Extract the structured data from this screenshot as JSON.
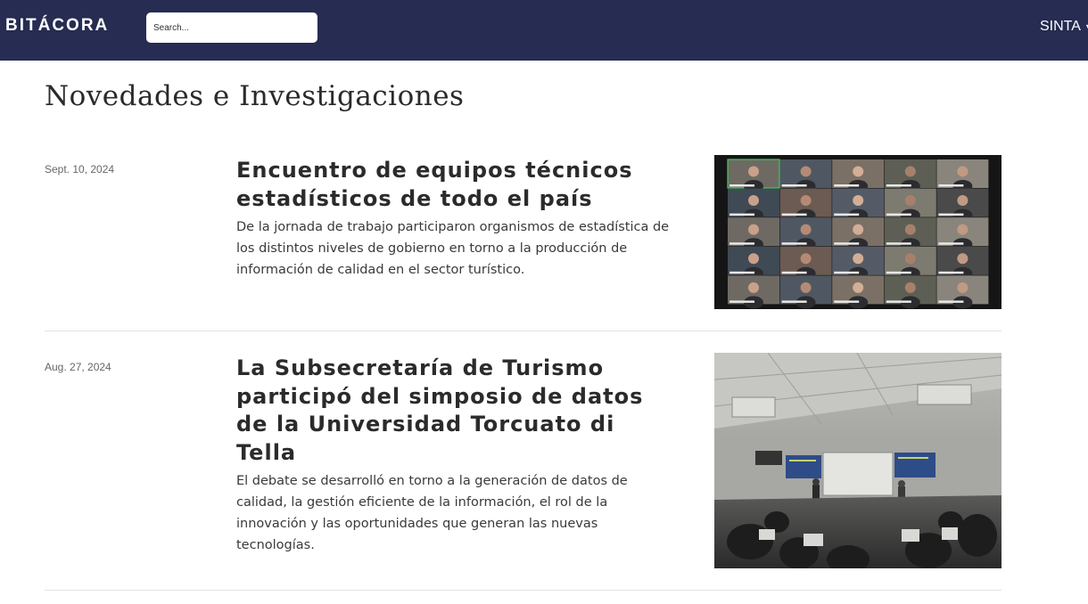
{
  "navbar": {
    "brand": "BITÁCORA",
    "search_placeholder": "Search...",
    "user_label": "SINTA",
    "caret": "▼"
  },
  "page": {
    "title": "Novedades e Investigaciones"
  },
  "articles": [
    {
      "date": "Sept. 10, 2024",
      "title": "Encuentro de equipos técnicos estadísticos de todo el país",
      "summary": "De la jornada de trabajo participaron organismos de estadística de los distintos niveles de gobierno en torno a la producción de información de calidad en el sector turístico."
    },
    {
      "date": "Aug. 27, 2024",
      "title": "La Subsecretaría de Turismo participó del simposio de datos de la Universidad Torcuato di Tella",
      "summary": "El debate se desarrolló en torno a la generación de datos de calidad, la gestión eficiente de la información, el rol de la innovación y las oportunidades que generan las nuevas tecnologías."
    }
  ]
}
